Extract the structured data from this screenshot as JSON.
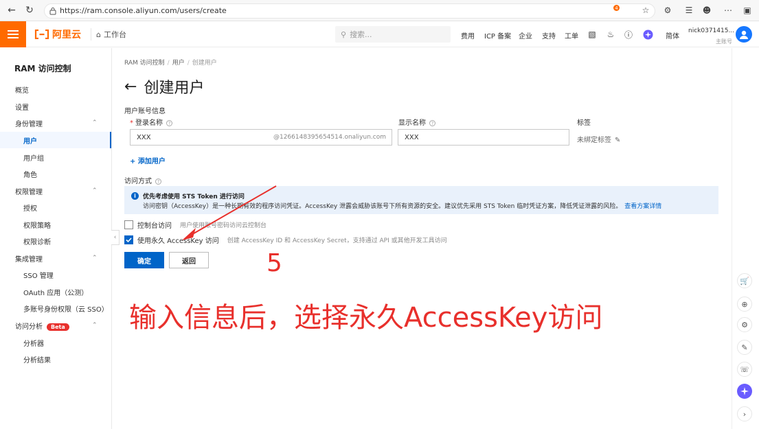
{
  "browser": {
    "url": "https://ram.console.aliyun.com/users/create"
  },
  "topbar": {
    "logo_text": "阿里云",
    "workbench": "工作台",
    "search_placeholder": "搜索...",
    "links": [
      "费用",
      "ICP 备案",
      "企业",
      "支持",
      "工单"
    ],
    "notification_count": "4",
    "language": "简体",
    "username": "nick0371415...",
    "account_role": "主账号"
  },
  "sidebar": {
    "title": "RAM 访问控制",
    "items": [
      {
        "label": "概览"
      },
      {
        "label": "设置"
      },
      {
        "label": "身份管理"
      },
      {
        "label": "用户"
      },
      {
        "label": "用户组"
      },
      {
        "label": "角色"
      },
      {
        "label": "权限管理"
      },
      {
        "label": "授权"
      },
      {
        "label": "权限策略"
      },
      {
        "label": "权限诊断"
      },
      {
        "label": "集成管理"
      },
      {
        "label": "SSO 管理"
      },
      {
        "label": "OAuth 应用（公测）"
      },
      {
        "label": "多账号身份权限（云 SSO）"
      },
      {
        "label": "访问分析"
      },
      {
        "label": "分析器"
      },
      {
        "label": "分析结果"
      }
    ],
    "beta_badge": "Beta"
  },
  "main": {
    "breadcrumb": [
      "RAM 访问控制",
      "用户",
      "创建用户"
    ],
    "page_title": "创建用户",
    "section_account": "用户账号信息",
    "login_name_label": "登录名称",
    "display_name_label": "显示名称",
    "tag_label": "标签",
    "login_name_value": "XXX",
    "login_name_suffix": "@1266148395654514.onaliyun.com",
    "display_name_value": "XXX",
    "tag_value": "未绑定标签",
    "add_user": "+ 添加用户",
    "access_mode_label": "访问方式",
    "info_title": "优先考虑使用 STS Token 进行访问",
    "info_body": "访问密钥（AccessKey）是一种长期有效的程序访问凭证。AccessKey 泄露会威胁该账号下所有资源的安全。建议优先采用 STS Token 临时凭证方案，降低凭证泄露的风险。",
    "info_link": "查看方案详情",
    "console_access_label": "控制台访问",
    "console_access_desc": "用户使用账号密码访问云控制台",
    "ak_access_label": "使用永久 AccessKey 访问",
    "ak_access_desc": "创建 AccessKey ID 和 AccessKey Secret，支持通过 API 或其他开发工具访问",
    "confirm_button": "确定",
    "back_button": "返回"
  },
  "annotation": {
    "step": "5",
    "text": "输入信息后，选择永久AccessKey访问",
    "color": "#e8302c"
  },
  "colors": {
    "brand": "#ff6a00",
    "primary": "#0064c8"
  }
}
